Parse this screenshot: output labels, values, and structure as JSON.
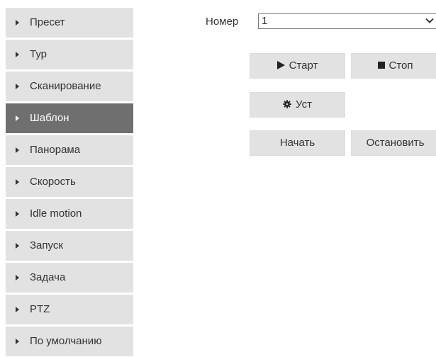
{
  "sidebar": {
    "items": [
      {
        "label": "Пресет",
        "active": false
      },
      {
        "label": "Тур",
        "active": false
      },
      {
        "label": "Сканирование",
        "active": false
      },
      {
        "label": "Шаблон",
        "active": true
      },
      {
        "label": "Панорама",
        "active": false
      },
      {
        "label": "Скорость",
        "active": false
      },
      {
        "label": "Idle motion",
        "active": false
      },
      {
        "label": "Запуск",
        "active": false
      },
      {
        "label": "Задача",
        "active": false
      },
      {
        "label": "PTZ",
        "active": false
      },
      {
        "label": "По умолчанию",
        "active": false
      }
    ]
  },
  "pattern": {
    "number_label": "Номер",
    "number_value": "1",
    "start_label": "Старт",
    "stop_label": "Стоп",
    "set_label": "Уст",
    "begin_label": "Начать",
    "end_label": "Остановить"
  },
  "colors": {
    "sidebar_bg": "#e2e2e2",
    "sidebar_active_bg": "#6f6f6f",
    "button_bg": "#e2e2e2",
    "accent_arc": "#3aa0ff"
  },
  "icons": {
    "item_marker": "triangle-right-icon",
    "start": "play-icon",
    "stop": "stop-square-icon",
    "set": "gear-icon",
    "dropdown": "chevron-down-icon"
  }
}
